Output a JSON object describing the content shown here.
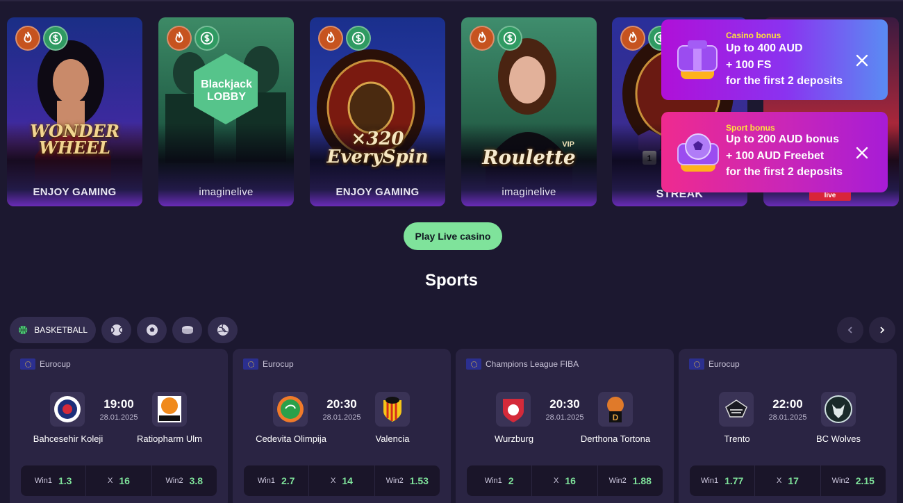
{
  "games": [
    {
      "title": "WONDER WHEEL",
      "provider": "ENJOY GAMING"
    },
    {
      "title": "Blackjack LOBBY",
      "provider": "imaginelive"
    },
    {
      "title": "×320 EverySpin",
      "provider": "ENJOY GAMING"
    },
    {
      "title": "Roulette",
      "badge_extra": "VIP",
      "provider": "imaginelive"
    },
    {
      "title": "STREAK",
      "provider": ""
    },
    {
      "title": "",
      "provider": "live"
    }
  ],
  "bonuses": {
    "casino": {
      "kicker": "Casino bonus",
      "line1": "Up to 400 AUD",
      "line2": "+ 100 FS",
      "line3": "for the first 2 deposits"
    },
    "sport": {
      "kicker": "Sport bonus",
      "line1": "Up to 200 AUD bonus",
      "line2": "+ 100 AUD Freebet",
      "line3": "for the first 2 deposits"
    }
  },
  "play_button": "Play Live casino",
  "sports_heading": "Sports",
  "filters": {
    "active_label": "BASKETBALL",
    "icons": [
      "basketball-icon",
      "tennis-icon",
      "football-icon",
      "hockey-puck-icon",
      "volleyball-icon"
    ]
  },
  "matches": [
    {
      "league": "Eurocup",
      "time": "19:00",
      "date": "28.01.2025",
      "home": "Bahcesehir Koleji",
      "away": "Ratiopharm Ulm",
      "odds": {
        "win1_label": "Win1",
        "win1": "1.3",
        "x_label": "X",
        "x": "16",
        "win2_label": "Win2",
        "win2": "3.8"
      }
    },
    {
      "league": "Eurocup",
      "time": "20:30",
      "date": "28.01.2025",
      "home": "Cedevita Olimpija",
      "away": "Valencia",
      "odds": {
        "win1_label": "Win1",
        "win1": "2.7",
        "x_label": "X",
        "x": "14",
        "win2_label": "Win2",
        "win2": "1.53"
      }
    },
    {
      "league": "Champions League FIBA",
      "time": "20:30",
      "date": "28.01.2025",
      "home": "Wurzburg",
      "away": "Derthona Tortona",
      "odds": {
        "win1_label": "Win1",
        "win1": "2",
        "x_label": "X",
        "x": "16",
        "win2_label": "Win2",
        "win2": "1.88"
      }
    },
    {
      "league": "Eurocup",
      "time": "22:00",
      "date": "28.01.2025",
      "home": "Trento",
      "away": "BC Wolves",
      "odds": {
        "win1_label": "Win1",
        "win1": "1.77",
        "x_label": "X",
        "x": "17",
        "win2_label": "Win2",
        "win2": "2.15"
      }
    }
  ],
  "colors": {
    "accent_green": "#7fe39b",
    "background": "#1c1830",
    "card": "#2a2443"
  }
}
